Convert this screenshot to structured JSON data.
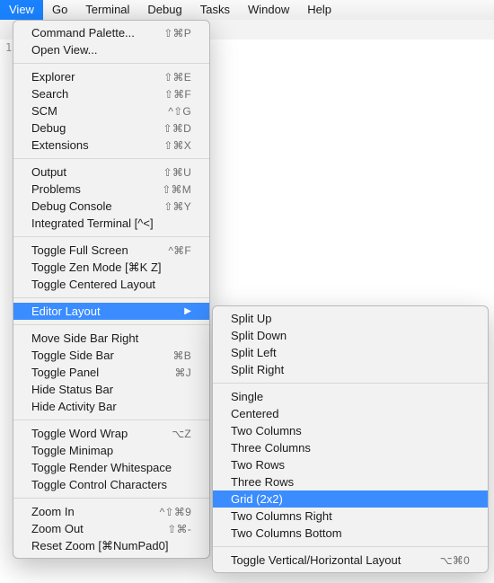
{
  "menubar": {
    "items": [
      {
        "label": "View",
        "selected": true
      },
      {
        "label": "Go"
      },
      {
        "label": "Terminal"
      },
      {
        "label": "Debug"
      },
      {
        "label": "Tasks"
      },
      {
        "label": "Window"
      },
      {
        "label": "Help"
      }
    ]
  },
  "editor": {
    "line_number": "1"
  },
  "view_menu": {
    "groups": [
      [
        {
          "label": "Command Palette...",
          "shortcut": "⇧⌘P"
        },
        {
          "label": "Open View..."
        }
      ],
      [
        {
          "label": "Explorer",
          "shortcut": "⇧⌘E"
        },
        {
          "label": "Search",
          "shortcut": "⇧⌘F"
        },
        {
          "label": "SCM",
          "shortcut": "^⇧G"
        },
        {
          "label": "Debug",
          "shortcut": "⇧⌘D"
        },
        {
          "label": "Extensions",
          "shortcut": "⇧⌘X"
        }
      ],
      [
        {
          "label": "Output",
          "shortcut": "⇧⌘U"
        },
        {
          "label": "Problems",
          "shortcut": "⇧⌘M"
        },
        {
          "label": "Debug Console",
          "shortcut": "⇧⌘Y"
        },
        {
          "label": "Integrated Terminal [^<]"
        }
      ],
      [
        {
          "label": "Toggle Full Screen",
          "shortcut": "^⌘F"
        },
        {
          "label": "Toggle Zen Mode [⌘K Z]"
        },
        {
          "label": "Toggle Centered Layout"
        }
      ],
      [
        {
          "label": "Editor Layout",
          "submenu": true,
          "selected": true
        }
      ],
      [
        {
          "label": "Move Side Bar Right"
        },
        {
          "label": "Toggle Side Bar",
          "shortcut": "⌘B"
        },
        {
          "label": "Toggle Panel",
          "shortcut": "⌘J"
        },
        {
          "label": "Hide Status Bar"
        },
        {
          "label": "Hide Activity Bar"
        }
      ],
      [
        {
          "label": "Toggle Word Wrap",
          "shortcut": "⌥Z"
        },
        {
          "label": "Toggle Minimap"
        },
        {
          "label": "Toggle Render Whitespace"
        },
        {
          "label": "Toggle Control Characters"
        }
      ],
      [
        {
          "label": "Zoom In",
          "shortcut": "^⇧⌘9"
        },
        {
          "label": "Zoom Out",
          "shortcut": "⇧⌘-"
        },
        {
          "label": "Reset Zoom [⌘NumPad0]"
        }
      ]
    ]
  },
  "layout_menu": {
    "groups": [
      [
        {
          "label": "Split Up"
        },
        {
          "label": "Split Down"
        },
        {
          "label": "Split Left"
        },
        {
          "label": "Split Right"
        }
      ],
      [
        {
          "label": "Single"
        },
        {
          "label": "Centered"
        },
        {
          "label": "Two Columns"
        },
        {
          "label": "Three Columns"
        },
        {
          "label": "Two Rows"
        },
        {
          "label": "Three Rows"
        },
        {
          "label": "Grid (2x2)",
          "selected": true
        },
        {
          "label": "Two Columns Right"
        },
        {
          "label": "Two Columns Bottom"
        }
      ],
      [
        {
          "label": "Toggle Vertical/Horizontal Layout",
          "shortcut": "⌥⌘0"
        }
      ]
    ]
  }
}
